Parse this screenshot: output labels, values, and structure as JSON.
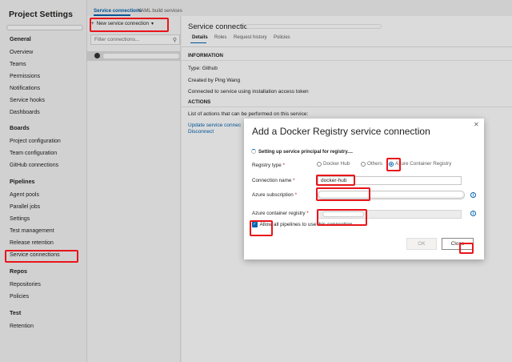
{
  "left_nav": {
    "title": "Project Settings",
    "sections": [
      {
        "heading": "General",
        "items": [
          "Overview",
          "Teams",
          "Permissions",
          "Notifications",
          "Service hooks",
          "Dashboards"
        ]
      },
      {
        "heading": "Boards",
        "items": [
          "Project configuration",
          "Team configuration",
          "GitHub connections"
        ]
      },
      {
        "heading": "Pipelines",
        "items": [
          "Agent pools",
          "Parallel jobs",
          "Settings",
          "Test management",
          "Release retention",
          "Service connections"
        ]
      },
      {
        "heading": "Repos",
        "items": [
          "Repositories",
          "Policies"
        ]
      },
      {
        "heading": "Test",
        "items": [
          "Retention"
        ]
      }
    ],
    "selected_item": "Service connections"
  },
  "top_tabs": [
    "Service connections",
    "XAML build services"
  ],
  "list_panel": {
    "new_button": "New service connection",
    "new_button_icon": "plus-icon",
    "filter_placeholder": "Filter connections...",
    "filter_icon": "search-icon",
    "item_icon": "github-icon"
  },
  "detail": {
    "title": "Service connection:",
    "tabs": [
      "Details",
      "Roles",
      "Request history",
      "Policies"
    ],
    "info_heading": "INFORMATION",
    "info_lines": [
      "Type: Github",
      "Created by Ping Wang",
      "Connected to service using installation access token"
    ],
    "actions_heading": "ACTIONS",
    "actions_intro": "List of actions that can be performed on this service:",
    "actions_links": [
      "Update service connec",
      "Disconnect"
    ]
  },
  "modal": {
    "title": "Add a Docker Registry service connection",
    "progress": "Setting up service principal for registry....",
    "registry_type_label": "Registry type",
    "registry_options": [
      "Docker Hub",
      "Others",
      "Azure Container Registry"
    ],
    "registry_selected": "Azure Container Registry",
    "connection_name_label": "Connection name",
    "connection_name_value": "docker-hub",
    "azure_subscription_label": "Azure subscription",
    "acr_label": "Azure container registry",
    "allow_pipelines_label": "Allow all pipelines to use this connection",
    "allow_pipelines_checked": true,
    "ok_label": "OK",
    "close_label": "Close",
    "required_mark": "*",
    "info_icon": "info-icon"
  },
  "colors": {
    "accent": "#0063b1",
    "annotation": "#e8151b"
  }
}
